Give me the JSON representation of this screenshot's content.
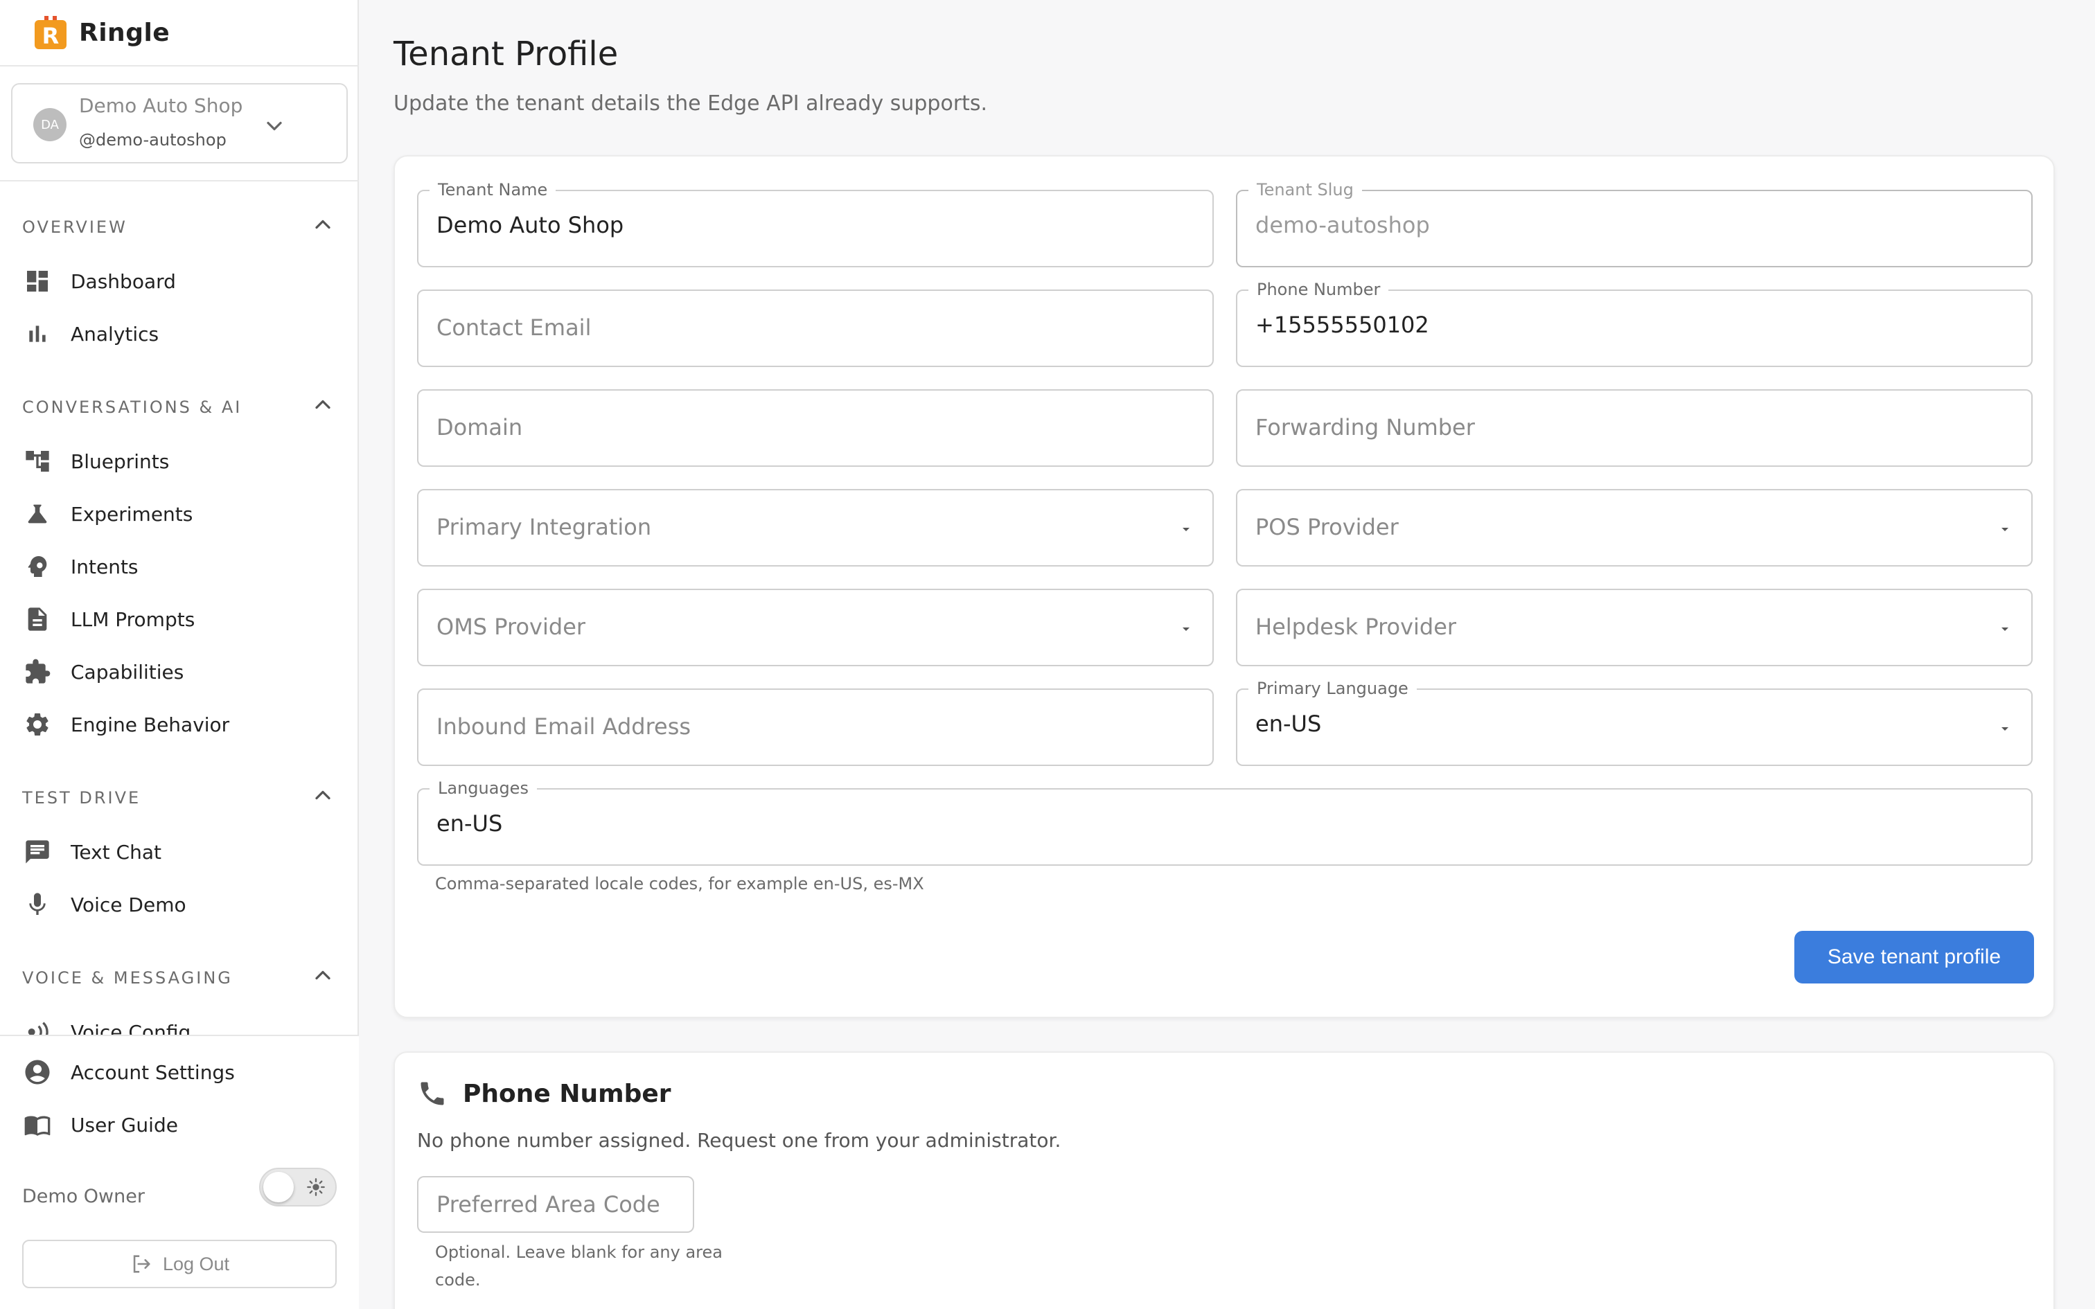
{
  "brand": {
    "name": "Ringle",
    "logo_letter": "R"
  },
  "tenant_switcher": {
    "avatar": "DA",
    "name": "Demo Auto Shop",
    "slug": "@demo-autoshop"
  },
  "nav": {
    "overview": {
      "title": "OVERVIEW",
      "items": [
        "Dashboard",
        "Analytics"
      ]
    },
    "conversations": {
      "title": "CONVERSATIONS & AI",
      "items": [
        "Blueprints",
        "Experiments",
        "Intents",
        "LLM Prompts",
        "Capabilities",
        "Engine Behavior"
      ]
    },
    "test_drive": {
      "title": "TEST DRIVE",
      "items": [
        "Text Chat",
        "Voice Demo"
      ]
    },
    "voice_messaging": {
      "title": "VOICE & MESSAGING",
      "items": [
        "Voice Config"
      ]
    }
  },
  "bottom": {
    "account_settings": "Account Settings",
    "user_guide": "User Guide",
    "owner": "Demo Owner",
    "logout": "Log Out"
  },
  "page": {
    "title": "Tenant Profile",
    "subtitle": "Update the tenant details the Edge API already supports."
  },
  "form": {
    "tenant_name": {
      "label": "Tenant Name",
      "value": "Demo Auto Shop"
    },
    "tenant_slug": {
      "label": "Tenant Slug",
      "value": "demo-autoshop"
    },
    "contact_email": {
      "placeholder": "Contact Email"
    },
    "phone_number": {
      "label": "Phone Number",
      "value": "+15555550102"
    },
    "domain": {
      "placeholder": "Domain"
    },
    "forwarding_number": {
      "placeholder": "Forwarding Number"
    },
    "primary_integration": {
      "placeholder": "Primary Integration"
    },
    "pos_provider": {
      "placeholder": "POS Provider"
    },
    "oms_provider": {
      "placeholder": "OMS Provider"
    },
    "helpdesk_provider": {
      "placeholder": "Helpdesk Provider"
    },
    "inbound_email": {
      "placeholder": "Inbound Email Address"
    },
    "primary_language": {
      "label": "Primary Language",
      "value": "en-US"
    },
    "languages": {
      "label": "Languages",
      "value": "en-US",
      "helper": "Comma-separated locale codes, for example en-US, es-MX"
    },
    "save_label": "Save tenant profile"
  },
  "phone_card": {
    "title": "Phone Number",
    "description": "No phone number assigned. Request one from your administrator.",
    "area_code_placeholder": "Preferred Area Code",
    "area_code_helper": "Optional. Leave blank for any area code."
  },
  "colors": {
    "accent": "#3b7ddd",
    "brand_orange": "#f29a1f",
    "brand_red": "#e5532d"
  }
}
